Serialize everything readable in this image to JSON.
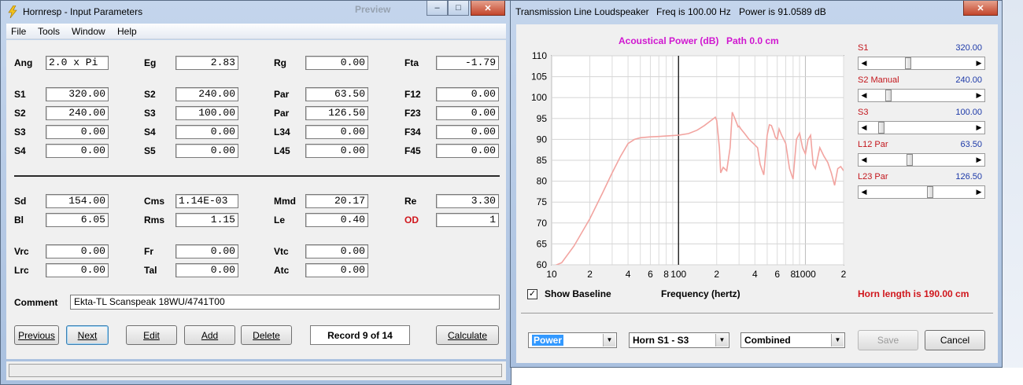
{
  "left_window": {
    "title": "Hornresp - Input Parameters",
    "bg_toolbar_text": "Preview",
    "menu": [
      "File",
      "Tools",
      "Window",
      "Help"
    ],
    "params": {
      "ang": {
        "label": "Ang",
        "value": "2.0 x Pi"
      },
      "eg": {
        "label": "Eg",
        "value": "2.83"
      },
      "rg": {
        "label": "Rg",
        "value": "0.00"
      },
      "fta": {
        "label": "Fta",
        "value": "-1.79"
      },
      "s1": {
        "label": "S1",
        "value": "320.00"
      },
      "s2a": {
        "label": "S2",
        "value": "240.00"
      },
      "par1": {
        "label": "Par",
        "value": "63.50"
      },
      "f12": {
        "label": "F12",
        "value": "0.00"
      },
      "s2b": {
        "label": "S2",
        "value": "240.00"
      },
      "s3a": {
        "label": "S3",
        "value": "100.00"
      },
      "par2": {
        "label": "Par",
        "value": "126.50"
      },
      "f23": {
        "label": "F23",
        "value": "0.00"
      },
      "s3b": {
        "label": "S3",
        "value": "0.00"
      },
      "s4a": {
        "label": "S4",
        "value": "0.00"
      },
      "l34": {
        "label": "L34",
        "value": "0.00"
      },
      "f34": {
        "label": "F34",
        "value": "0.00"
      },
      "s4b": {
        "label": "S4",
        "value": "0.00"
      },
      "s5": {
        "label": "S5",
        "value": "0.00"
      },
      "l45": {
        "label": "L45",
        "value": "0.00"
      },
      "f45": {
        "label": "F45",
        "value": "0.00"
      },
      "sd": {
        "label": "Sd",
        "value": "154.00"
      },
      "cms": {
        "label": "Cms",
        "value": "1.14E-03"
      },
      "mmd": {
        "label": "Mmd",
        "value": "20.17"
      },
      "re": {
        "label": "Re",
        "value": "3.30"
      },
      "bl": {
        "label": "Bl",
        "value": "6.05"
      },
      "rms": {
        "label": "Rms",
        "value": "1.15"
      },
      "le": {
        "label": "Le",
        "value": "0.40"
      },
      "od": {
        "label": "OD",
        "value": "1"
      },
      "vrc": {
        "label": "Vrc",
        "value": "0.00"
      },
      "fr": {
        "label": "Fr",
        "value": "0.00"
      },
      "vtc": {
        "label": "Vtc",
        "value": "0.00"
      },
      "lrc": {
        "label": "Lrc",
        "value": "0.00"
      },
      "tal": {
        "label": "Tal",
        "value": "0.00"
      },
      "atc": {
        "label": "Atc",
        "value": "0.00"
      }
    },
    "comment_label": "Comment",
    "comment_value": "Ekta-TL Scanspeak  18WU/4741T00",
    "buttons": {
      "previous": "Previous",
      "next": "Next",
      "edit": "Edit",
      "add": "Add",
      "delete": "Delete",
      "calculate": "Calculate"
    },
    "record": "Record 9 of 14"
  },
  "right_window": {
    "title": "Transmission Line Loudspeaker",
    "freq": "Freq is 100.00 Hz",
    "power": "Power is 91.0589 dB",
    "chart_title": "Acoustical Power (dB)",
    "path": "Path 0.0 cm",
    "sliders": [
      {
        "label": "S1",
        "value": "320.00",
        "position": 0.36
      },
      {
        "label": "S2  Manual",
        "value": "240.00",
        "position": 0.16
      },
      {
        "label": "S3",
        "value": "100.00",
        "position": 0.09
      },
      {
        "label": "L12  Par",
        "value": "63.50",
        "position": 0.38
      },
      {
        "label": "L23  Par",
        "value": "126.50",
        "position": 0.59
      }
    ],
    "show_baseline": "Show Baseline",
    "baseline_checked": "✓",
    "horn_length": "Horn length is 190.00 cm",
    "combos": {
      "mode": "Power",
      "range": "Horn S1 - S3",
      "combination": "Combined"
    },
    "buttons": {
      "save": "Save",
      "cancel": "Cancel"
    }
  },
  "chart_data": {
    "type": "line",
    "xlabel": "Frequency (hertz)",
    "x_scale": "log",
    "xlim": [
      10,
      2000
    ],
    "ylim": [
      60,
      110
    ],
    "x_ticks": [
      10,
      20,
      40,
      60,
      80,
      100,
      200,
      400,
      600,
      800,
      1000,
      2000
    ],
    "x_tick_labels": [
      "10",
      "2",
      "4",
      "6",
      "8",
      "100",
      "2",
      "4",
      "6",
      "8",
      "1000",
      "2"
    ],
    "y_ticks": [
      60,
      65,
      70,
      75,
      80,
      85,
      90,
      95,
      100,
      105,
      110
    ],
    "grid": true,
    "marker_x": 100,
    "series_color": "#f2a4a0",
    "series": [
      {
        "x": [
          10,
          12,
          15,
          20,
          25,
          30,
          35,
          40,
          45,
          50,
          60,
          70,
          80,
          100,
          120,
          140,
          160,
          180,
          195,
          200,
          210,
          215,
          225,
          240,
          255,
          265,
          280,
          295,
          300,
          310,
          330,
          360,
          390,
          420,
          440,
          470,
          500,
          520,
          540,
          560,
          580,
          600,
          620,
          650,
          700,
          750,
          800,
          850,
          900,
          950,
          1000,
          1050,
          1100,
          1150,
          1200,
          1300,
          1400,
          1500,
          1600,
          1700,
          1800,
          1900,
          2000
        ],
        "y": [
          59.5,
          60.5,
          64.5,
          71,
          77,
          82,
          86,
          89,
          90,
          90.4,
          90.6,
          90.7,
          90.8,
          91,
          91.4,
          92.2,
          93.3,
          94.5,
          95.3,
          94.5,
          88,
          82,
          83.3,
          82.5,
          88,
          96.5,
          94.8,
          93,
          93.2,
          92.5,
          91.5,
          90,
          89,
          88,
          84,
          81.5,
          91,
          93.5,
          93.3,
          92,
          90.5,
          90,
          92.5,
          91,
          89,
          83,
          80.5,
          90,
          91.5,
          88,
          86.5,
          90,
          91,
          84,
          83,
          88,
          86,
          84.5,
          82,
          79,
          83,
          83.5,
          82.5
        ]
      }
    ]
  }
}
